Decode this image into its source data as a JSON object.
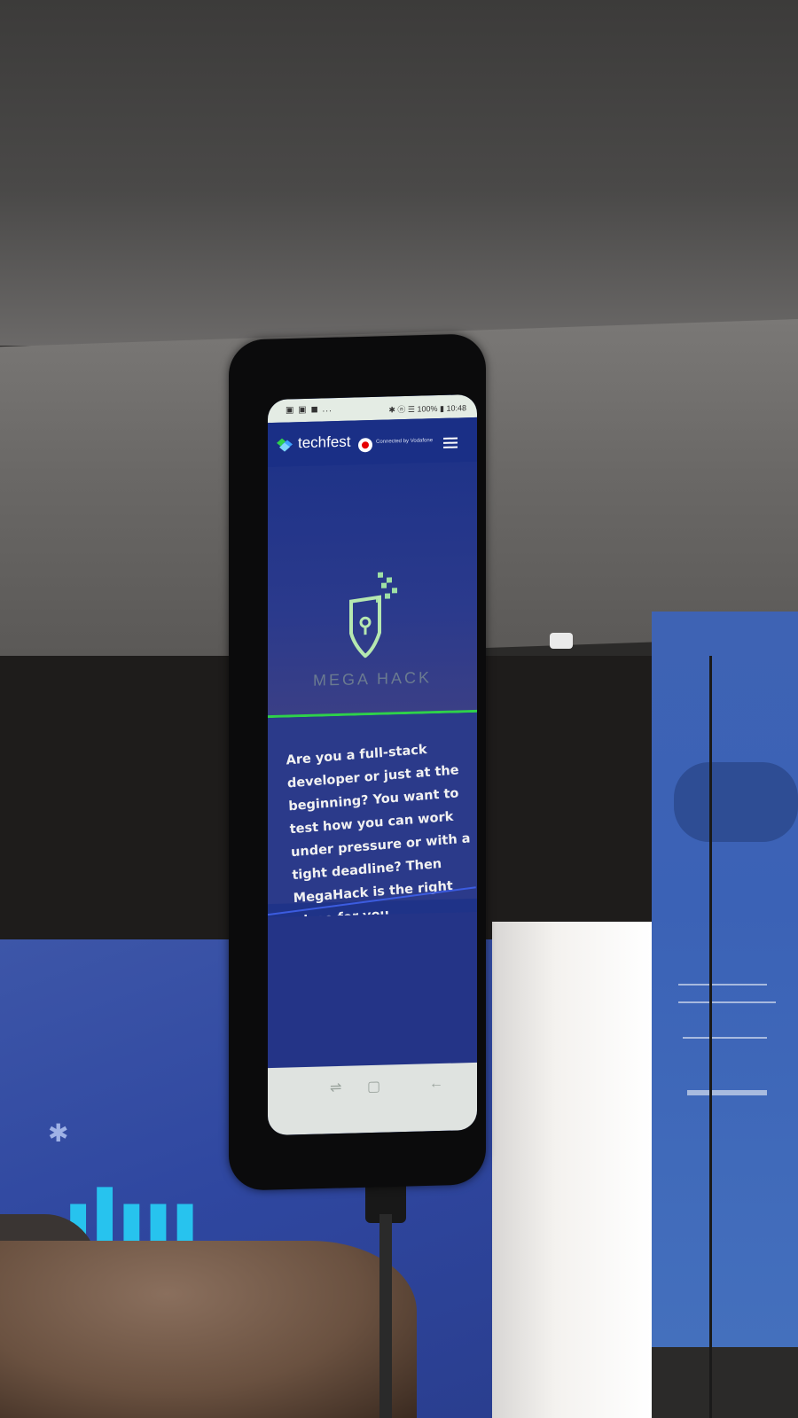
{
  "photo": {
    "ceiling_color": "#4a4948",
    "banner_color": "#3b62b6",
    "hand_color": "#6a5140"
  },
  "phone": {
    "status_bar": {
      "left_icons": "▣ ▣ ◼ ...",
      "right_text": "✱ ⓝ ☰ 100% ▮ 10:48"
    },
    "header": {
      "logo_text": "techfest",
      "partner_text": "Connected by Vodafone",
      "menu_icon": "hamburger-menu-icon"
    },
    "hero": {
      "title": "MEGA HACK",
      "icon": "shield-lock-icon"
    },
    "body": {
      "text": "Are you a full-stack developer or just at the beginning? You want to test how you can work under pressure or with a tight deadline? Then MegaHack is the right place for you."
    },
    "nav": {
      "recent_icon": "recent-apps-icon",
      "home_icon": "home-button-icon",
      "back_icon": "back-arrow-icon"
    }
  },
  "accent_colors": {
    "green_rule": "#2fd14a",
    "blue_rule": "#3c5ce0",
    "screen_bg": "#1f3388"
  }
}
